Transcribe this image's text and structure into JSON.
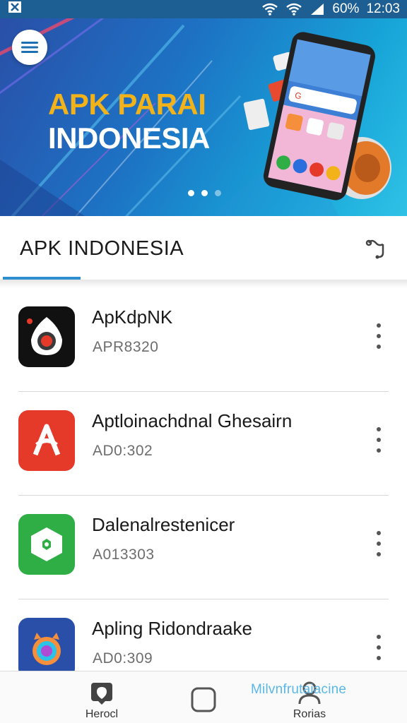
{
  "status_bar": {
    "battery": "60%",
    "time": "12:03",
    "icons": [
      "notification-icon",
      "wifi-icon",
      "wifi-icon",
      "signal-icon"
    ]
  },
  "banner": {
    "title_line1": "APK PARAI",
    "title_line2": "INDONESIA",
    "carousel_total": 3,
    "carousel_active": 1
  },
  "header": {
    "title": "APK INDONESIA",
    "action_icon": "share-icon"
  },
  "apps": [
    {
      "name": "ApKdpNK",
      "code": "APR8320",
      "icon": "camera-lens-icon",
      "color": "#111111"
    },
    {
      "name": "Aptloinachdnal  Ghesairn",
      "code": "AD0:302",
      "icon": "letter-a-icon",
      "color": "#e53a2a"
    },
    {
      "name": "Dalenalrestenicer",
      "code": "A013303",
      "icon": "shield-icon",
      "color": "#2eae45"
    },
    {
      "name": "Apling Ridondraake",
      "code": "AD0:309",
      "icon": "ring-icon",
      "color": "#2a4fa8"
    }
  ],
  "bottom_nav": {
    "home_label": "Herocl",
    "profile_label": "Rorias",
    "overlay_text": "Milvnfrutaiacine"
  }
}
